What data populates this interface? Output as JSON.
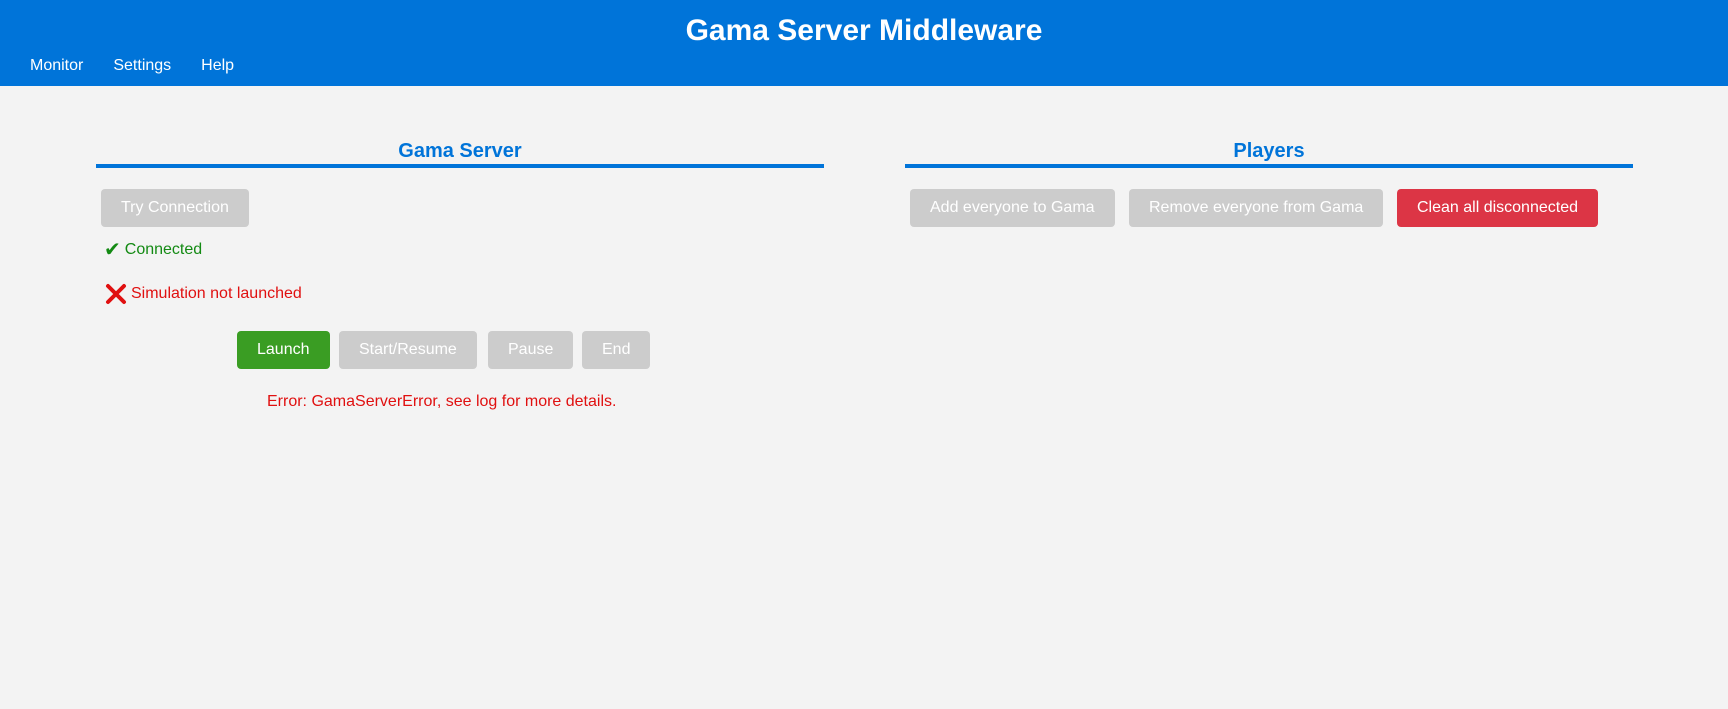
{
  "header": {
    "title": "Gama Server Middleware",
    "nav": [
      {
        "label": "Monitor"
      },
      {
        "label": "Settings"
      },
      {
        "label": "Help"
      }
    ]
  },
  "gama_server": {
    "title": "Gama Server",
    "try_connection_label": "Try Connection",
    "connection_status": "Connected",
    "simulation_status": "Simulation not launched",
    "controls": {
      "launch": "Launch",
      "start_resume": "Start/Resume",
      "pause": "Pause",
      "end": "End"
    },
    "error": "Error: GamaServerError, see log for more details."
  },
  "players": {
    "title": "Players",
    "add_everyone": "Add everyone to Gama",
    "remove_everyone": "Remove everyone from Gama",
    "clean_disconnected": "Clean all disconnected"
  },
  "colors": {
    "primary": "#0074d9",
    "success": "#3a9d23",
    "danger": "#dc3545",
    "disabled": "#cccccc",
    "error_text": "#e01010",
    "ok_text": "#138a13"
  },
  "icons": {
    "connection_status": "check-icon",
    "simulation_status": "cross-icon"
  }
}
